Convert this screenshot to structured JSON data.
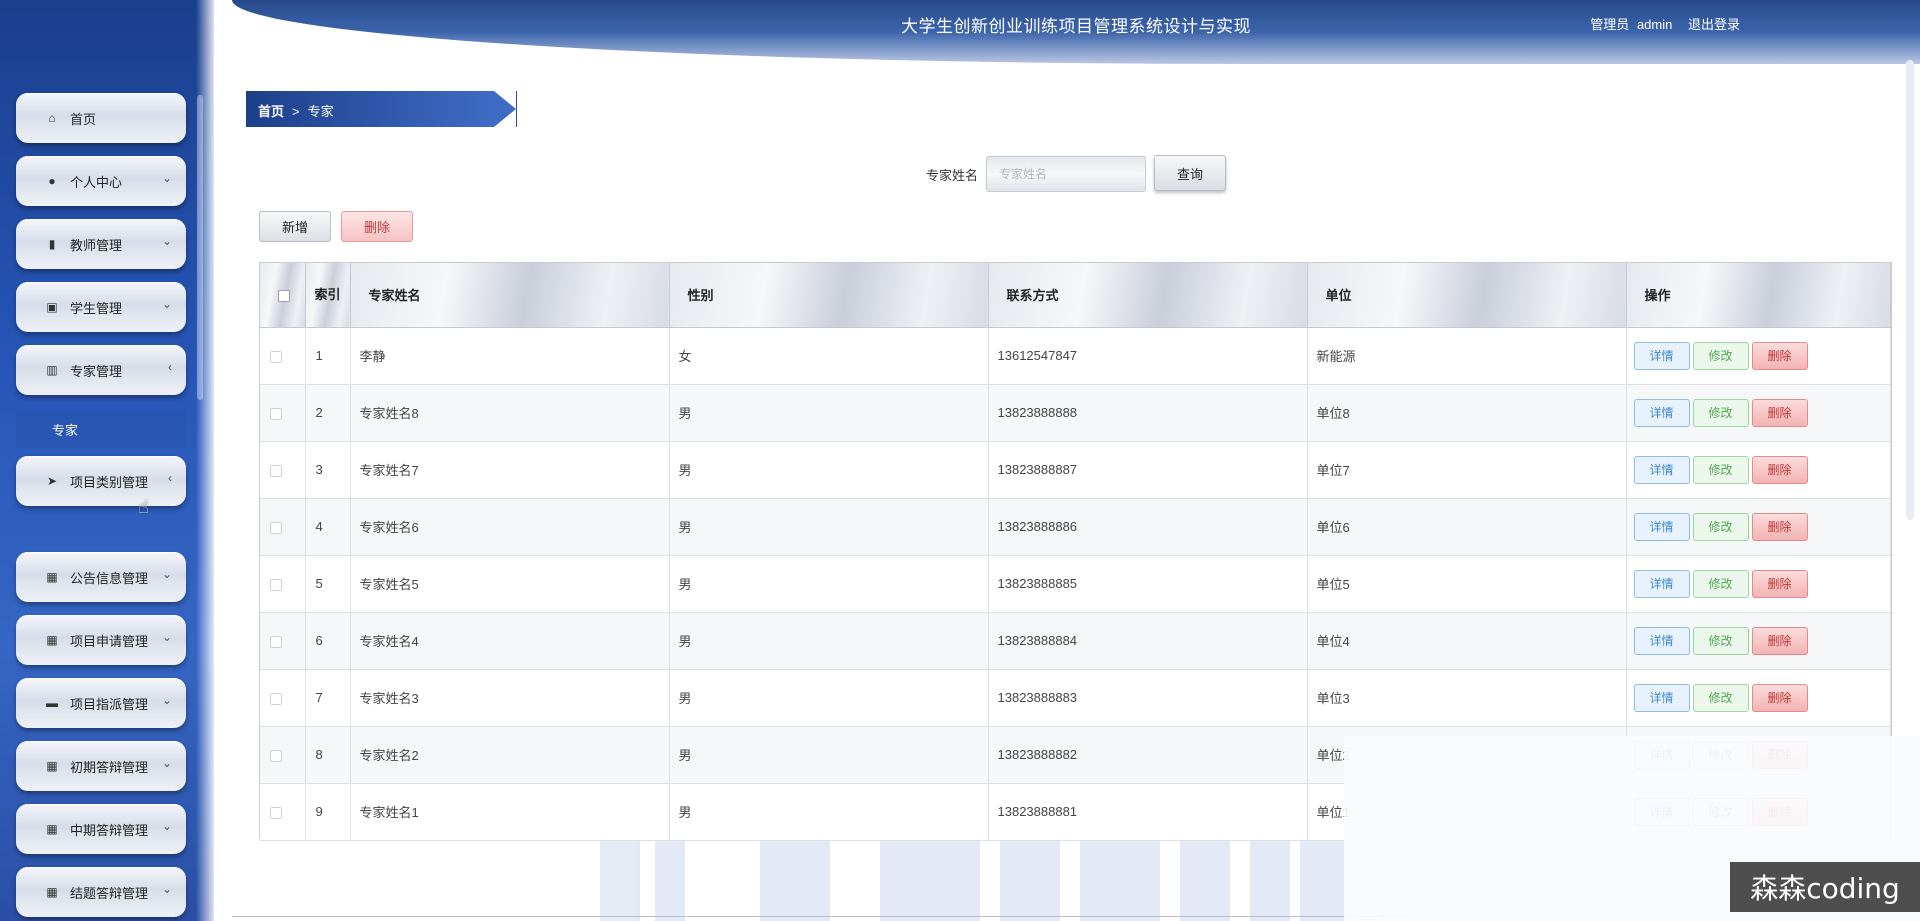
{
  "app": {
    "title": "大学生创新创业训练项目管理系统设计与实现",
    "user_role": "管理员",
    "username": "admin",
    "logout_label": "退出登录"
  },
  "sidebar": {
    "items": [
      {
        "label": "首页",
        "icon": "home-icon",
        "glyph": "⌂",
        "arrow": ""
      },
      {
        "label": "个人中心",
        "icon": "user-icon",
        "glyph": "●",
        "arrow": "⌄"
      },
      {
        "label": "教师管理",
        "icon": "bar-chart-icon",
        "glyph": "▮",
        "arrow": "⌄"
      },
      {
        "label": "学生管理",
        "icon": "clipboard-icon",
        "glyph": "▣",
        "arrow": "⌄"
      },
      {
        "label": "专家管理",
        "icon": "stats-icon",
        "glyph": "▥",
        "arrow": "‹"
      },
      {
        "label": "项目类别管理",
        "icon": "send-icon",
        "glyph": "➤",
        "arrow": "‹"
      },
      {
        "label": "公告信息管理",
        "icon": "grid-icon",
        "glyph": "▦",
        "arrow": "⌄"
      },
      {
        "label": "项目申请管理",
        "icon": "grid-icon",
        "glyph": "▦",
        "arrow": "⌄"
      },
      {
        "label": "项目指派管理",
        "icon": "desktop-icon",
        "glyph": "▬",
        "arrow": "⌄"
      },
      {
        "label": "初期答辩管理",
        "icon": "grid-icon",
        "glyph": "▦",
        "arrow": "⌄"
      },
      {
        "label": "中期答辩管理",
        "icon": "grid-icon",
        "glyph": "▦",
        "arrow": "⌄"
      },
      {
        "label": "结题答辩管理",
        "icon": "grid-icon",
        "glyph": "▦",
        "arrow": "⌄"
      }
    ],
    "submenu_active": "专家"
  },
  "breadcrumb": {
    "home": "首页",
    "separator": ">",
    "current": "专家"
  },
  "search": {
    "label": "专家姓名",
    "placeholder": "专家姓名",
    "button": "查询"
  },
  "actions": {
    "add": "新增",
    "delete": "删除"
  },
  "table": {
    "headers": {
      "index": "索引",
      "name": "专家姓名",
      "gender": "性别",
      "contact": "联系方式",
      "unit": "单位",
      "ops": "操作"
    },
    "rows": [
      {
        "index": "1",
        "name": "李静",
        "gender": "女",
        "contact": "13612547847",
        "unit": "新能源"
      },
      {
        "index": "2",
        "name": "专家姓名8",
        "gender": "男",
        "contact": "13823888888",
        "unit": "单位8"
      },
      {
        "index": "3",
        "name": "专家姓名7",
        "gender": "男",
        "contact": "13823888887",
        "unit": "单位7"
      },
      {
        "index": "4",
        "name": "专家姓名6",
        "gender": "男",
        "contact": "13823888886",
        "unit": "单位6"
      },
      {
        "index": "5",
        "name": "专家姓名5",
        "gender": "男",
        "contact": "13823888885",
        "unit": "单位5"
      },
      {
        "index": "6",
        "name": "专家姓名4",
        "gender": "男",
        "contact": "13823888884",
        "unit": "单位4"
      },
      {
        "index": "7",
        "name": "专家姓名3",
        "gender": "男",
        "contact": "13823888883",
        "unit": "单位3"
      },
      {
        "index": "8",
        "name": "专家姓名2",
        "gender": "男",
        "contact": "13823888882",
        "unit": "单位2"
      },
      {
        "index": "9",
        "name": "专家姓名1",
        "gender": "男",
        "contact": "13823888881",
        "unit": "单位1"
      }
    ],
    "row_ops": {
      "detail": "详情",
      "edit": "修改",
      "delete": "删除"
    }
  },
  "watermark": "森森coding"
}
